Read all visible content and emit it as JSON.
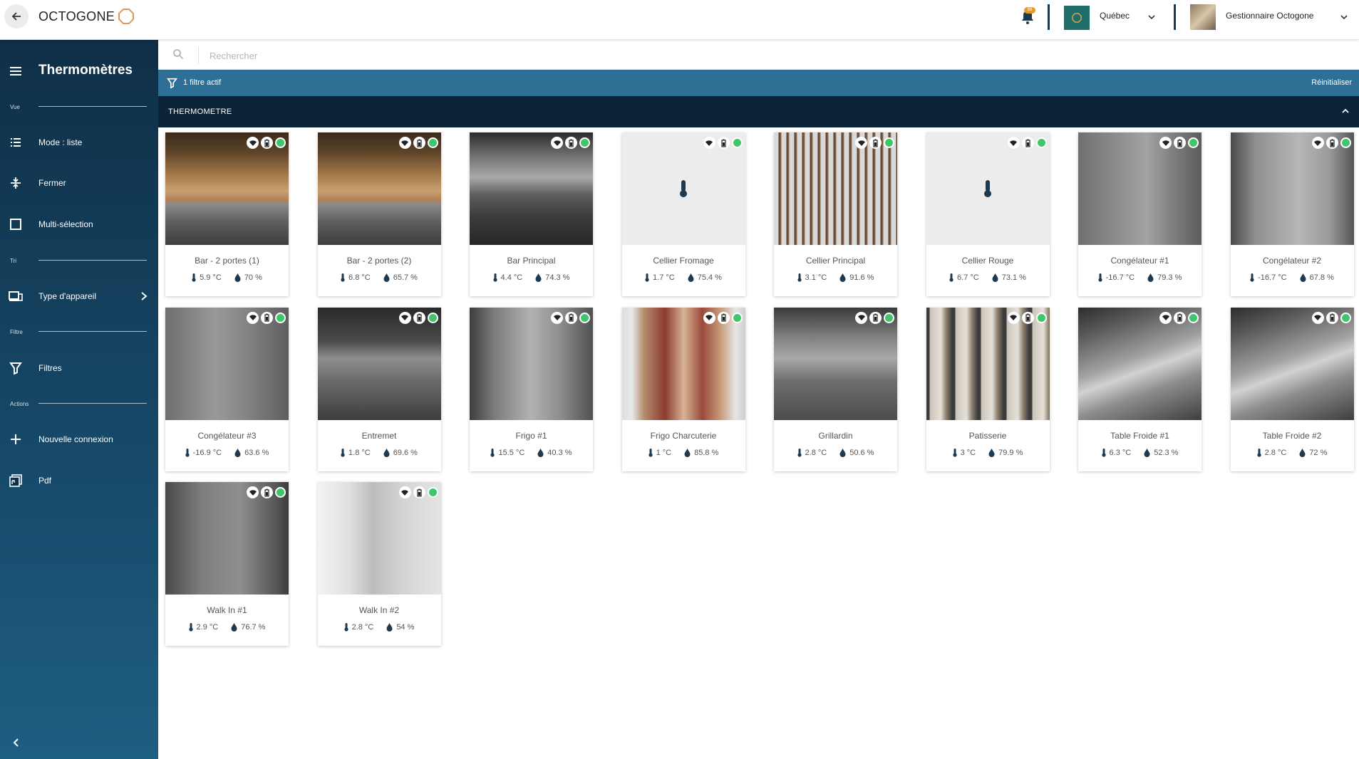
{
  "app": {
    "logo_text": "OCTOGONE"
  },
  "header": {
    "notification_badge": "99",
    "location_label": "Québec",
    "user_name": "Gestionnaire Octogone"
  },
  "sidebar": {
    "title": "Thermomètres",
    "sections": {
      "vue": "Vue",
      "tri": "Tri",
      "filtre": "Filtre",
      "actions": "Actions"
    },
    "items": {
      "mode": "Mode : liste",
      "fermer": "Fermer",
      "multi": "Multi-sélection",
      "type": "Type d'appareil",
      "filtres": "Filtres",
      "nouvelle": "Nouvelle connexion",
      "pdf": "Pdf"
    }
  },
  "search": {
    "placeholder": "Rechercher"
  },
  "filter_bar": {
    "text": "1 filtre actif",
    "reset": "Réinitialiser"
  },
  "group": {
    "title": "THERMOMETRE"
  },
  "colors": {
    "accent": "#2e6f95",
    "dark": "#0c2438",
    "status_ok": "#3fc66b"
  },
  "devices": [
    {
      "name": "Bar - 2 portes (1)",
      "temp": "5.9 °C",
      "humidity": "70 %",
      "photo": "ph-bar",
      "has_photo": true
    },
    {
      "name": "Bar - 2 portes (2)",
      "temp": "6.8 °C",
      "humidity": "65.7 %",
      "photo": "ph-bar",
      "has_photo": true
    },
    {
      "name": "Bar Principal",
      "temp": "4.4 °C",
      "humidity": "74.3 %",
      "photo": "ph-barp",
      "has_photo": true
    },
    {
      "name": "Cellier Fromage",
      "temp": "1.7 °C",
      "humidity": "75.4 %",
      "photo": "",
      "has_photo": false
    },
    {
      "name": "Cellier Principal",
      "temp": "3.1 °C",
      "humidity": "91.6 %",
      "photo": "ph-wine",
      "has_photo": true
    },
    {
      "name": "Cellier Rouge",
      "temp": "6.7 °C",
      "humidity": "73.1 %",
      "photo": "",
      "has_photo": false
    },
    {
      "name": "Congélateur #1",
      "temp": "-16.7 °C",
      "humidity": "79.3 %",
      "photo": "ph-cong",
      "has_photo": true
    },
    {
      "name": "Congélateur #2",
      "temp": "-16.7 °C",
      "humidity": "67.8 %",
      "photo": "ph-cong2",
      "has_photo": true
    },
    {
      "name": "Congélateur #3",
      "temp": "-16.9 °C",
      "humidity": "63.6 %",
      "photo": "ph-cong3",
      "has_photo": true
    },
    {
      "name": "Entremet",
      "temp": "1.8 °C",
      "humidity": "69.6 %",
      "photo": "ph-ent",
      "has_photo": true
    },
    {
      "name": "Frigo #1",
      "temp": "15.5 °C",
      "humidity": "40.3 %",
      "photo": "ph-frigo",
      "has_photo": true
    },
    {
      "name": "Frigo Charcuterie",
      "temp": "1 °C",
      "humidity": "85.8 %",
      "photo": "ph-charc",
      "has_photo": true
    },
    {
      "name": "Grillardin",
      "temp": "2.8 °C",
      "humidity": "50.6 %",
      "photo": "ph-grill",
      "has_photo": true
    },
    {
      "name": "Patisserie",
      "temp": "3 °C",
      "humidity": "79.9 %",
      "photo": "ph-pat",
      "has_photo": true
    },
    {
      "name": "Table Froide #1",
      "temp": "6.3 °C",
      "humidity": "52.3 %",
      "photo": "ph-tf",
      "has_photo": true
    },
    {
      "name": "Table Froide #2",
      "temp": "2.8 °C",
      "humidity": "72 %",
      "photo": "ph-tf",
      "has_photo": true
    },
    {
      "name": "Walk In #1",
      "temp": "2.9 °C",
      "humidity": "76.7 %",
      "photo": "ph-walk1",
      "has_photo": true
    },
    {
      "name": "Walk In #2",
      "temp": "2.8 °C",
      "humidity": "54 %",
      "photo": "ph-walk2",
      "has_photo": true
    }
  ]
}
